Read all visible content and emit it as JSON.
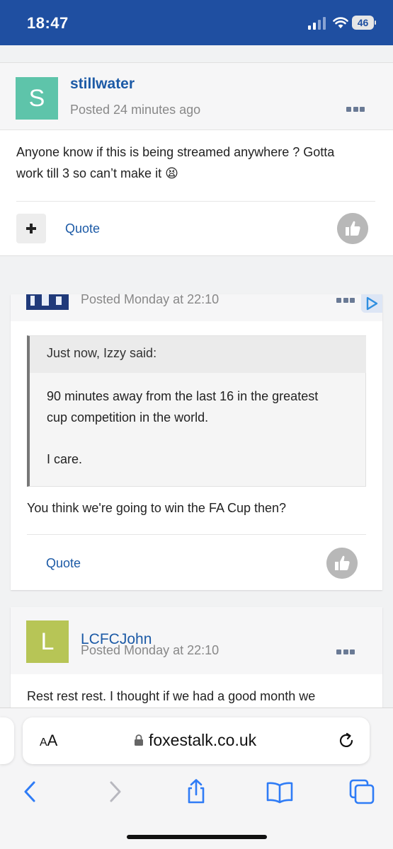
{
  "status_bar": {
    "time": "18:47",
    "battery": "46"
  },
  "posts": [
    {
      "author": "stillwater",
      "avatar_letter": "S",
      "avatar_color": "#5ec4aa",
      "posted": "Posted 24 minutes ago",
      "content_line1": "Anyone know if this is being streamed anywhere ? Gotta",
      "content_line2": "work till 3 so can’t make it 😫",
      "quote_label": "Quote"
    },
    {
      "posted": "Posted Monday at 22:10",
      "quote_attribution": "Just now, Izzy said:",
      "quoted_line1": "90 minutes away from the last 16 in the greatest",
      "quoted_line2": "cup competition in the world.",
      "quoted_line3": "I care.",
      "content": "You think we're going to win the FA Cup then?",
      "quote_label": "Quote"
    },
    {
      "author": "LCFCJohn",
      "avatar_letter": "L",
      "avatar_color": "#b7c556",
      "posted": "Posted Monday at 22:10",
      "content": "Rest rest rest. I thought if we had a good month we"
    }
  ],
  "browser": {
    "text_size_label_small": "A",
    "text_size_label_large": "A",
    "url": "foxestalk.co.uk"
  },
  "colors": {
    "header_blue": "#1f4fa1",
    "link_blue": "#1c5aa6",
    "ios_blue": "#2f7cf6"
  },
  "icons": [
    "signal-icon",
    "wifi-icon",
    "battery-icon",
    "ellipsis-icon",
    "plus-icon",
    "thumbs-up-icon",
    "lock-icon",
    "reload-icon",
    "back-icon",
    "forward-icon",
    "share-icon",
    "bookmarks-icon",
    "tabs-icon"
  ]
}
